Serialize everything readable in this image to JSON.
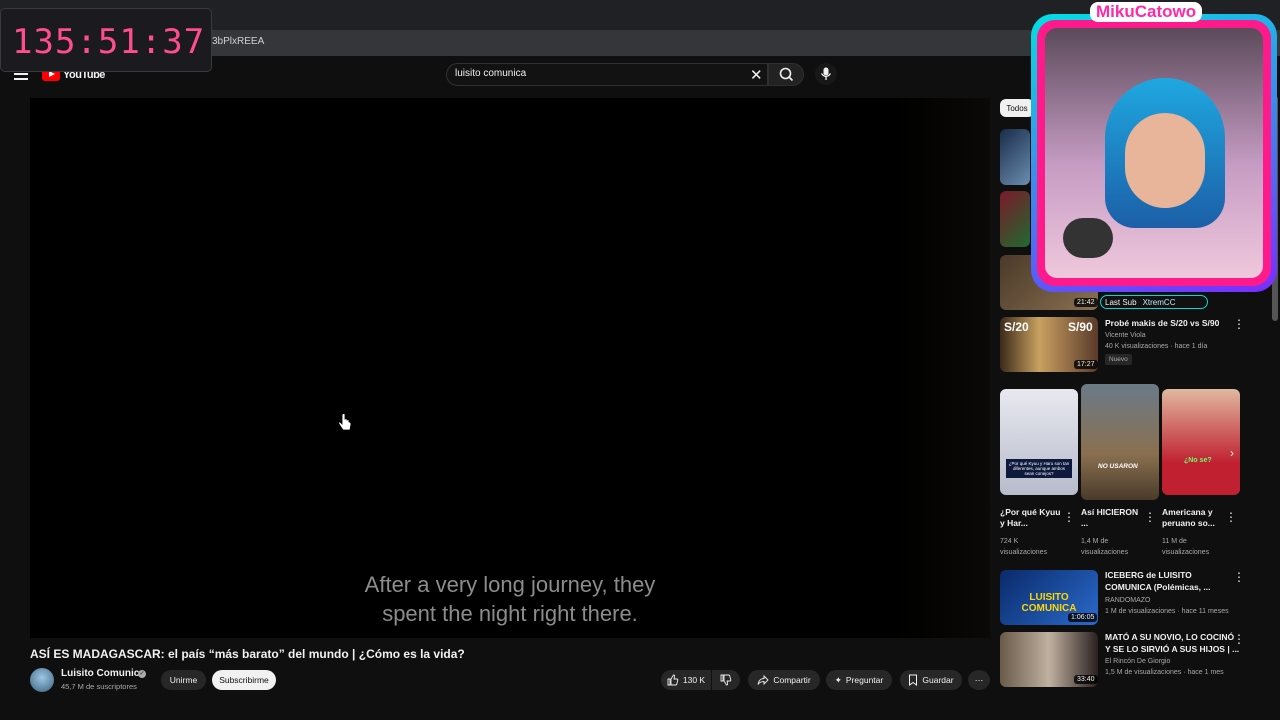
{
  "browser": {
    "url_fragment": "3bPlxREEA"
  },
  "overlay": {
    "timer": "135:51:37",
    "streamer_name": "MikuCatowo",
    "last_sub_label": "Last Sub",
    "last_sub_name": "XtremCC"
  },
  "header": {
    "logo_text": "YouTube",
    "search_value": "luisito comunica"
  },
  "player": {
    "caption_line1": "After a very long journey, they",
    "caption_line2": "spent the night right there."
  },
  "video": {
    "title": "ASÍ ES MADAGASCAR: el país “más barato” del mundo | ¿Cómo es la vida?",
    "channel": "Luisito Comunica",
    "subscribers": "45,7 M de suscriptores",
    "join_label": "Unirme",
    "subscribe_label": "Subscribirme",
    "likes": "130 K",
    "share_label": "Compartir",
    "ask_label": "Preguntar",
    "save_label": "Guardar"
  },
  "sidebar": {
    "chip_all": "Todos",
    "partial_durations": [
      "21:42"
    ],
    "rec1": {
      "title": "Probé makis de S/20 vs S/90",
      "channel": "Vicente Viola",
      "meta": "40 K visualizaciones · hace 1 día",
      "badge": "Nuevo",
      "duration": "17:27",
      "thumb_left": "S/20",
      "thumb_right": "S/90"
    },
    "shorts": [
      {
        "title": "¿Por qué Kyuu y Har...",
        "views": "724 K",
        "views_suffix": "visualizaciones",
        "thumb_text": "¿Por qué Kyuu y Haru son tan diferentes, aunque ambos sean conejos?"
      },
      {
        "title": "Así HICIERON ...",
        "views": "1,4 M de",
        "views_suffix": "visualizaciones",
        "thumb_text": "NO USARON"
      },
      {
        "title": "Americana y peruano so...",
        "views": "11 M de",
        "views_suffix": "visualizaciones",
        "thumb_text": "¿No se?"
      }
    ],
    "rec2": {
      "title_line1": "ICEBERG de LUISITO",
      "title_line2": "COMUNICA (Polémicas, ...",
      "channel": "RANDOMAZO",
      "meta": "1 M de visualizaciones · hace 11 meses",
      "duration": "1:06:05",
      "thumb_text": "LUISITO COMUNICA"
    },
    "rec3": {
      "title_line1": "MATÓ A SU NOVIO, LO COCINÓ",
      "title_line2": "Y SE LO SIRVIÓ A SUS HIJOS | ...",
      "channel": "El Rincón De Giorgio",
      "meta": "1,5 M de visualizaciones · hace 1 mes",
      "duration": "33:40"
    }
  },
  "colors": {
    "accent_red": "#ff0000",
    "overlay_pink": "#ff1a8c",
    "overlay_cyan": "#00e0e0",
    "timer_pink": "#ff4d8d"
  }
}
